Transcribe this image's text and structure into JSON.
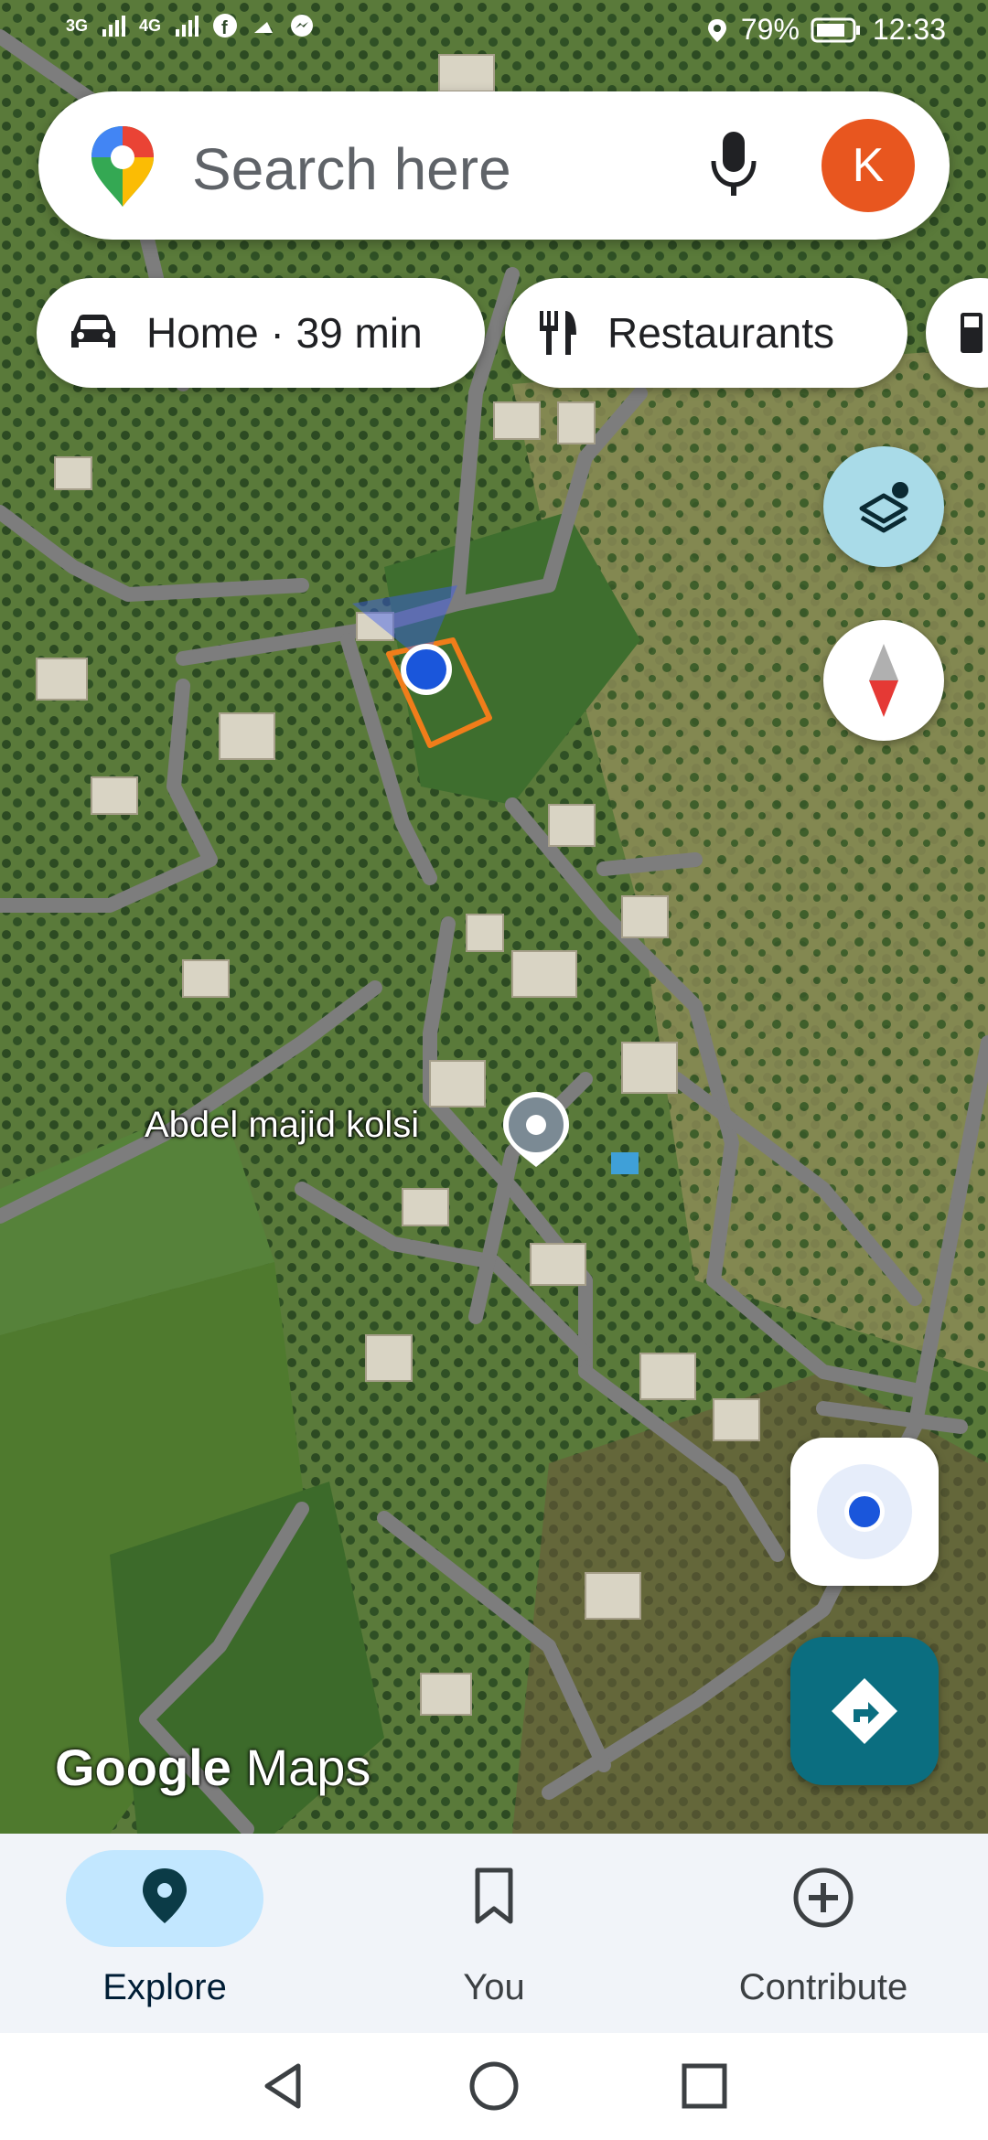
{
  "status_bar": {
    "network1": "3G",
    "network2": "4G",
    "battery": "79%",
    "time": "12:33"
  },
  "search": {
    "placeholder": "Search here",
    "avatar_letter": "K"
  },
  "chips": [
    {
      "label": "Home · 39 min",
      "icon": "car-icon"
    },
    {
      "label": "Restaurants",
      "icon": "fork-knife-icon"
    },
    {
      "label": "",
      "icon": "gas-station-icon"
    }
  ],
  "map": {
    "place_label": "Abdel majid kolsi",
    "brand_word1": "Google",
    "brand_word2": "Maps"
  },
  "bottom_nav": [
    {
      "label": "Explore",
      "icon": "location-pin-icon",
      "active": true
    },
    {
      "label": "You",
      "icon": "bookmark-icon",
      "active": false
    },
    {
      "label": "Contribute",
      "icon": "add-circle-icon",
      "active": false
    }
  ],
  "colors": {
    "accent": "#0b6e80",
    "avatar": "#e8561f",
    "nav_active": "#c2e7ff",
    "user_location": "#1a56db",
    "parcel_outline": "#f07d1a"
  }
}
